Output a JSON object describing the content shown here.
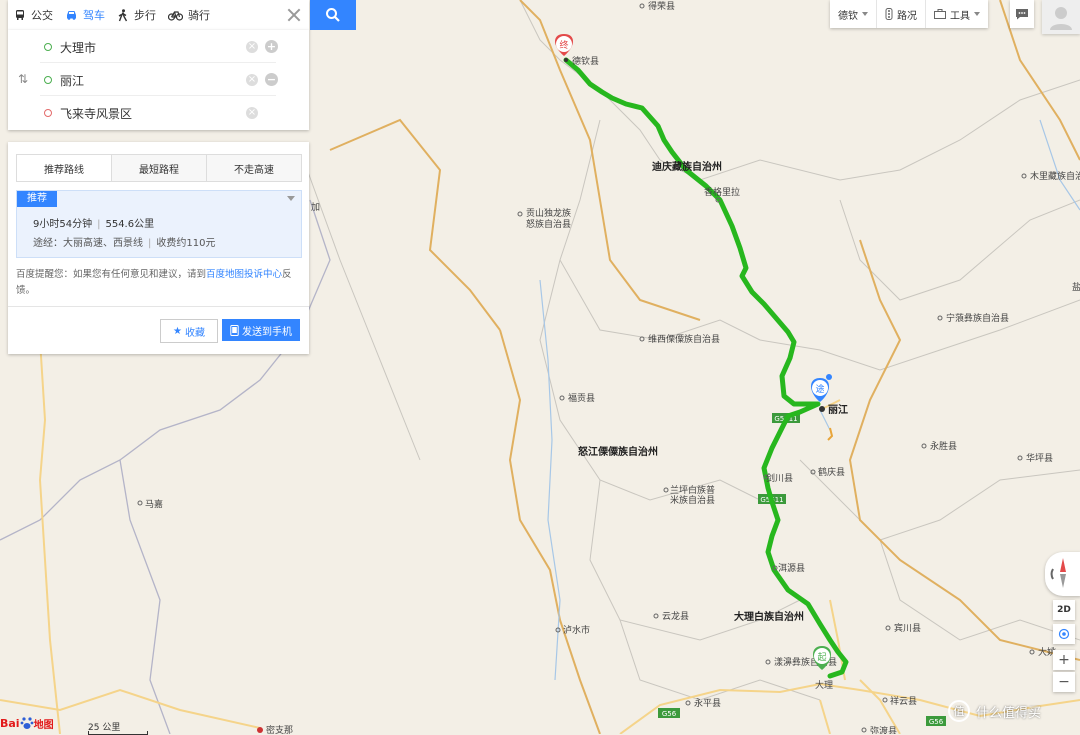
{
  "mode_tabs": [
    {
      "label": "公交",
      "icon": "bus-icon"
    },
    {
      "label": "驾车",
      "icon": "car-icon"
    },
    {
      "label": "步行",
      "icon": "walk-icon"
    },
    {
      "label": "骑行",
      "icon": "bike-icon"
    }
  ],
  "active_mode": "驾车",
  "stops": {
    "start": "大理市",
    "via": "丽江",
    "end": "飞来寺风景区"
  },
  "route_tabs": [
    "推荐路线",
    "最短路程",
    "不走高速"
  ],
  "route": {
    "badge": "推荐",
    "duration": "9小时54分钟",
    "distance": "554.6公里",
    "via_text": "途经：大丽高速、西景线",
    "toll_text": "收费约110元"
  },
  "note": {
    "before": "百度提醒您：如果您有任何意见和建议，请到",
    "link": "百度地图投诉中心",
    "after": "反馈。"
  },
  "buttons": {
    "favorite": "收藏",
    "send": "发送到手机"
  },
  "toolbar": {
    "city": "德钦",
    "traffic": "路况",
    "tools": "工具"
  },
  "controls": {
    "view_2d": "2D"
  },
  "scale_label": "25 公里",
  "logo_text": "地图",
  "watermark": "什么值得买",
  "map": {
    "labels": [
      {
        "text": "得荣县",
        "kind": "county"
      },
      {
        "text": "德钦县",
        "kind": "county"
      },
      {
        "text": "迪庆藏族自治州",
        "kind": "region"
      },
      {
        "text": "香格里拉",
        "kind": "county"
      },
      {
        "text": "贡山独龙族",
        "kind": "county"
      },
      {
        "text": "怒族自治县",
        "kind": "county-2"
      },
      {
        "text": "维西傈僳族自治县",
        "kind": "county"
      },
      {
        "text": "福贡县",
        "kind": "county"
      },
      {
        "text": "怒江傈僳族自治州",
        "kind": "region"
      },
      {
        "text": "丽江",
        "kind": "city"
      },
      {
        "text": "剑川县",
        "kind": "county"
      },
      {
        "text": "鹤庆县",
        "kind": "county"
      },
      {
        "text": "兰坪白族普",
        "kind": "county"
      },
      {
        "text": "米族自治县",
        "kind": "county-2"
      },
      {
        "text": "洱源县",
        "kind": "county"
      },
      {
        "text": "云龙县",
        "kind": "county"
      },
      {
        "text": "大理白族自治州",
        "kind": "region"
      },
      {
        "text": "泸水市",
        "kind": "county"
      },
      {
        "text": "漾濞彝族自治县",
        "kind": "county"
      },
      {
        "text": "大理",
        "kind": "county"
      },
      {
        "text": "永平县",
        "kind": "county"
      },
      {
        "text": "祥云县",
        "kind": "county"
      },
      {
        "text": "弥渡县",
        "kind": "county"
      },
      {
        "text": "宾川县",
        "kind": "county"
      },
      {
        "text": "永胜县",
        "kind": "county"
      },
      {
        "text": "宁蒗彝族自治县",
        "kind": "county"
      },
      {
        "text": "木里藏族自治县",
        "kind": "county"
      },
      {
        "text": "华坪县",
        "kind": "county"
      },
      {
        "text": "大姚",
        "kind": "county"
      },
      {
        "text": "马嘉",
        "kind": "county"
      },
      {
        "text": "密支那",
        "kind": "county"
      },
      {
        "text": "加",
        "kind": "county"
      },
      {
        "text": "盐",
        "kind": "county"
      }
    ],
    "shields": [
      "G5611",
      "G5611",
      "G56",
      "G56"
    ],
    "markers": {
      "start": "起",
      "via": "途",
      "end": "终"
    },
    "colors": {
      "route": "#27b71e",
      "land": "#f3efe6",
      "highway": "#f5d48a",
      "province": "#e0b060",
      "river": "#a7c7e7",
      "accent": "#3385ff"
    }
  }
}
